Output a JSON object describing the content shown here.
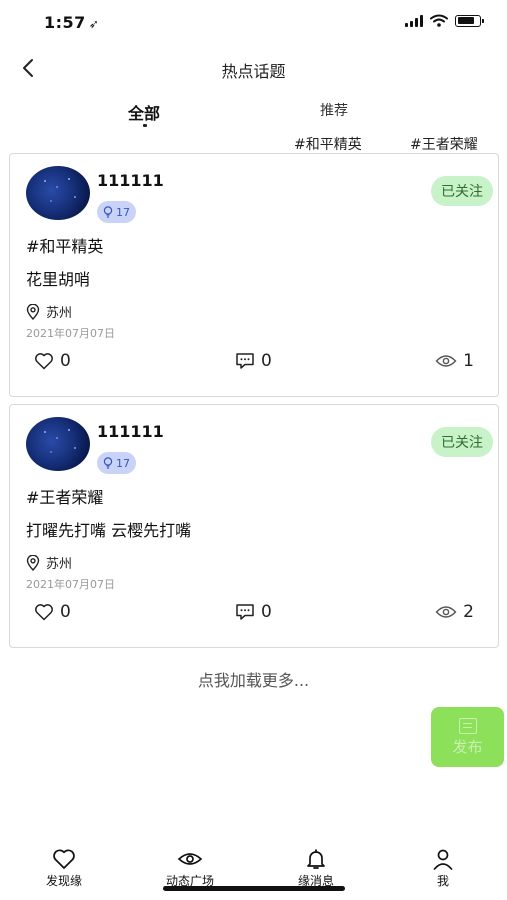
{
  "status_bar": {
    "time": "1:57",
    "location_arrow": "➶"
  },
  "header": {
    "title": "热点话题",
    "back_icon": "chevron-left-icon"
  },
  "tabs": [
    {
      "label": "全部",
      "active": true
    },
    {
      "label": "推荐",
      "active": false
    }
  ],
  "subtags": [
    "#和平精英",
    "#王者荣耀"
  ],
  "posts": [
    {
      "username": "111111",
      "level": "17",
      "follow_label": "已关注",
      "topic": "#和平精英",
      "content": "花里胡哨",
      "location": "苏州",
      "date": "2021年07月07日",
      "likes": "0",
      "comments": "0",
      "views": "1"
    },
    {
      "username": "111111",
      "level": "17",
      "follow_label": "已关注",
      "topic": "#王者荣耀",
      "content": "打曜先打嘴 云樱先打嘴",
      "location": "苏州",
      "date": "2021年07月07日",
      "likes": "0",
      "comments": "0",
      "views": "2"
    }
  ],
  "load_more": "点我加载更多...",
  "publish_label": "发布",
  "bottom_nav": [
    {
      "label": "发现缘",
      "icon": "heart-icon"
    },
    {
      "label": "动态广场",
      "icon": "eye-icon"
    },
    {
      "label": "缘消息",
      "icon": "bell-icon"
    },
    {
      "label": "我",
      "icon": "person-icon"
    }
  ],
  "colors": {
    "follow_bg": "#c8f2c8",
    "publish_bg": "#8ce05a",
    "level_badge_bg": "#c9d3f7"
  }
}
